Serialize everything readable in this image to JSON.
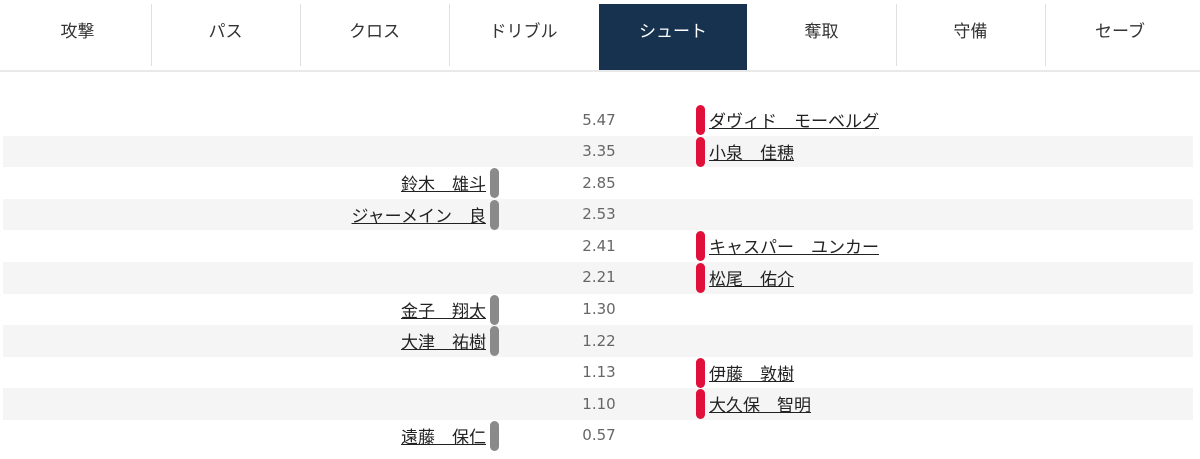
{
  "tabs": [
    {
      "label": "攻撃",
      "active": false
    },
    {
      "label": "パス",
      "active": false
    },
    {
      "label": "クロス",
      "active": false
    },
    {
      "label": "ドリブル",
      "active": false
    },
    {
      "label": "シュート",
      "active": true
    },
    {
      "label": "奪取",
      "active": false
    },
    {
      "label": "守備",
      "active": false
    },
    {
      "label": "セーブ",
      "active": false
    }
  ],
  "colors": {
    "active_tab": "#17324f",
    "left_team": "#8a8a8a",
    "right_team": "#e0103a"
  },
  "rankings": [
    {
      "score": "5.47",
      "name": "ダヴィド　モーベルグ",
      "side": "right"
    },
    {
      "score": "3.35",
      "name": "小泉　佳穂",
      "side": "right"
    },
    {
      "score": "2.85",
      "name": "鈴木　雄斗",
      "side": "left"
    },
    {
      "score": "2.53",
      "name": "ジャーメイン　良",
      "side": "left"
    },
    {
      "score": "2.41",
      "name": "キャスパー　ユンカー",
      "side": "right"
    },
    {
      "score": "2.21",
      "name": "松尾　佑介",
      "side": "right"
    },
    {
      "score": "1.30",
      "name": "金子　翔太",
      "side": "left"
    },
    {
      "score": "1.22",
      "name": "大津　祐樹",
      "side": "left"
    },
    {
      "score": "1.13",
      "name": "伊藤　敦樹",
      "side": "right"
    },
    {
      "score": "1.10",
      "name": "大久保　智明",
      "side": "right"
    },
    {
      "score": "0.57",
      "name": "遠藤　保仁",
      "side": "left"
    }
  ]
}
